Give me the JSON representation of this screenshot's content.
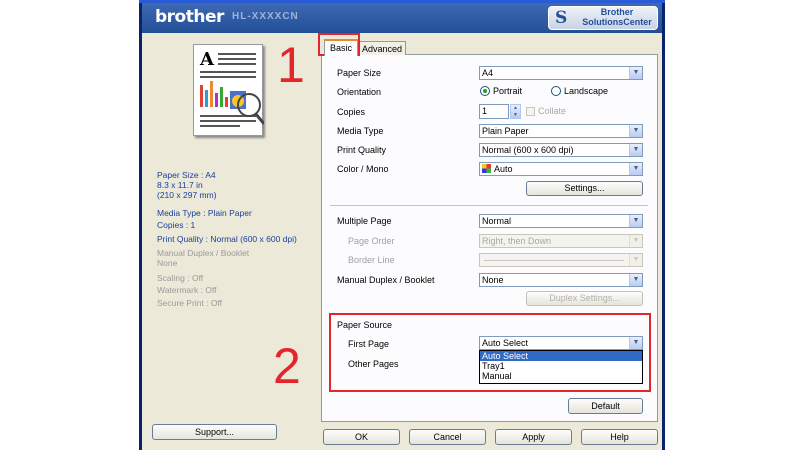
{
  "header": {
    "brand": "brother",
    "model": "HL-XXXXCN",
    "solutions_btn": {
      "line1": "Brother",
      "line2": "SolutionsCenter"
    }
  },
  "summary": {
    "paper_size": "Paper Size : A4",
    "dims1": "8.3 x 11.7 in",
    "dims2": "(210 x 297 mm)",
    "media_type": "Media Type : Plain Paper",
    "copies": "Copies : 1",
    "print_quality": "Print Quality : Normal (600 x 600 dpi)",
    "duplex_label": "Manual Duplex / Booklet",
    "duplex_value": "None",
    "scaling": "Scaling : Off",
    "watermark": "Watermark : Off",
    "secure_print": "Secure Print : Off"
  },
  "support_label": "Support...",
  "tabs": {
    "basic": "Basic",
    "advanced": "Advanced"
  },
  "form": {
    "paper_size": {
      "label": "Paper Size",
      "value": "A4"
    },
    "orientation": {
      "label": "Orientation",
      "portrait": "Portrait",
      "landscape": "Landscape",
      "selected": "Portrait"
    },
    "copies": {
      "label": "Copies",
      "value": "1",
      "collate": "Collate"
    },
    "media_type": {
      "label": "Media Type",
      "value": "Plain Paper"
    },
    "print_quality": {
      "label": "Print Quality",
      "value": "Normal (600 x 600 dpi)"
    },
    "color_mono": {
      "label": "Color / Mono",
      "value": "Auto"
    },
    "settings_btn": "Settings...",
    "multiple_page": {
      "label": "Multiple Page",
      "value": "Normal"
    },
    "page_order": {
      "label": "Page Order",
      "value": "Right, then Down"
    },
    "border_line": {
      "label": "Border Line",
      "value": ""
    },
    "manual_duplex": {
      "label": "Manual Duplex / Booklet",
      "value": "None"
    },
    "duplex_settings_btn": "Duplex Settings...",
    "paper_source": {
      "title": "Paper Source",
      "first_page_label": "First Page",
      "first_page_value": "Auto Select",
      "other_pages_label": "Other Pages",
      "options": [
        "Auto Select",
        "Tray1",
        "Manual"
      ],
      "highlighted": "Auto Select"
    },
    "default_btn": "Default"
  },
  "footer": {
    "ok": "OK",
    "cancel": "Cancel",
    "apply": "Apply",
    "help": "Help"
  },
  "annotations": {
    "step1": "1",
    "step2": "2"
  },
  "colors": {
    "header": "#234f97",
    "annotation": "#e3262c",
    "summary_text": "#1a3f9e",
    "highlight": "#316ac5"
  }
}
